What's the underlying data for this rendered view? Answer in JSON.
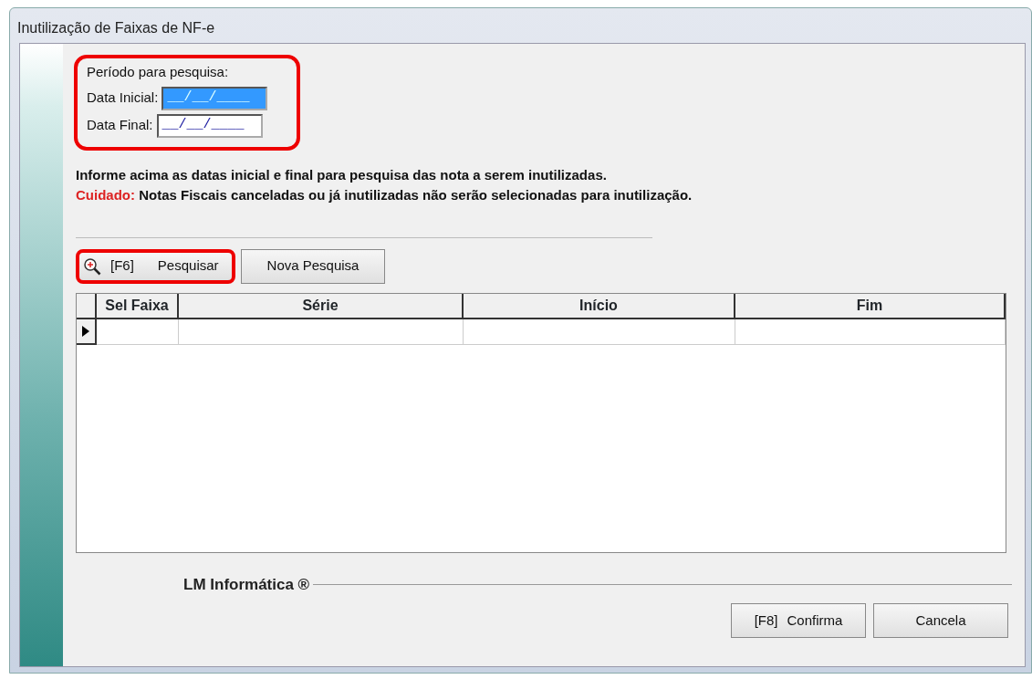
{
  "window": {
    "title": "Inutilização de Faixas de NF-e"
  },
  "period": {
    "heading": "Período para pesquisa:",
    "highlighted": true,
    "fields": [
      {
        "label": "Data Inicial:",
        "value": "__/__/____",
        "selected": true
      },
      {
        "label": "Data Final:",
        "value": "__/__/____",
        "selected": false
      }
    ]
  },
  "notes": [
    {
      "kind": "plain",
      "text": "Informe acima as datas inicial e final para pesquisa das nota a serem inutilizadas."
    },
    {
      "kind": "warning",
      "prefix": "Cuidado:",
      "text": "Notas Fiscais canceladas ou já inutilizadas não serão selecionadas para inutilização."
    }
  ],
  "search_buttons": [
    {
      "kind": "search",
      "shortcut": "[F6]",
      "label": "Pesquisar",
      "highlighted": true
    },
    {
      "kind": "plain",
      "label": "Nova Pesquisa",
      "highlighted": false
    }
  ],
  "table": {
    "columns": [
      "Sel Faixa",
      "Série",
      "Início",
      "Fim"
    ],
    "current_row_marker": true
  },
  "footer": {
    "brand": "LM Informática ®",
    "buttons": [
      {
        "shortcut": "[F8]",
        "label": "Confirma"
      },
      {
        "label": "Cancela"
      }
    ]
  }
}
